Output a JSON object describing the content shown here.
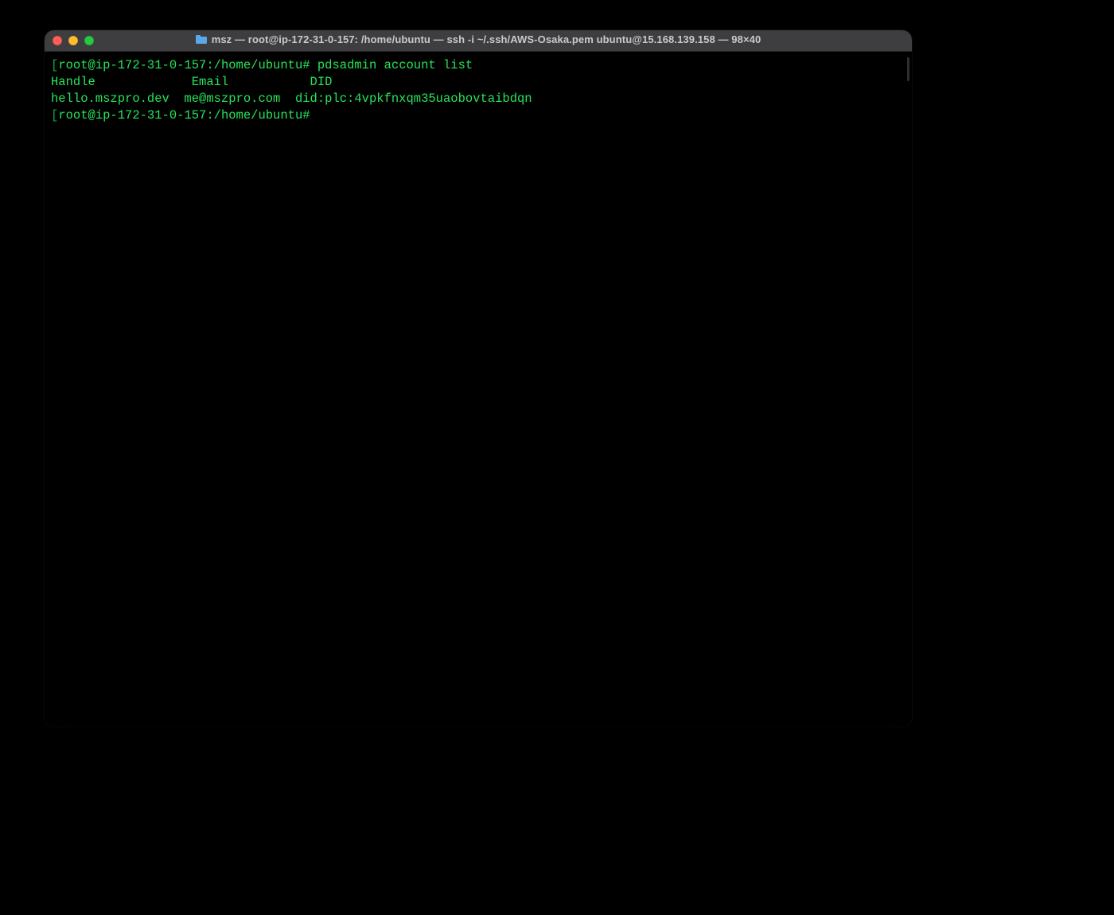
{
  "window": {
    "title": "msz — root@ip-172-31-0-157: /home/ubuntu — ssh -i ~/.ssh/AWS-Osaka.pem ubuntu@15.168.139.158 — 98×40"
  },
  "terminal": {
    "lines": [
      {
        "prompt_open": "[",
        "prompt": "root@ip-172-31-0-157:/home/ubuntu# ",
        "cmd": "pdsadmin account list"
      },
      {
        "text": "Handle             Email           DID"
      },
      {
        "text": "hello.mszpro.dev  me@mszpro.com  did:plc:4vpkfnxqm35uaobovtaibdqn"
      },
      {
        "prompt_open": "[",
        "prompt": "root@ip-172-31-0-157:/home/ubuntu# ",
        "cmd": ""
      }
    ]
  }
}
